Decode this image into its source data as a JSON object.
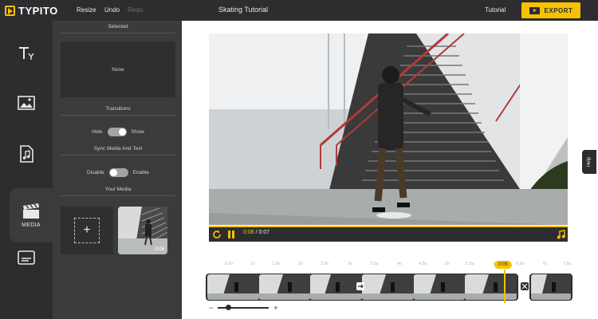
{
  "app": {
    "logo_text": "TYPITO",
    "title": "Skating Tutorial"
  },
  "topbar": {
    "resize_label": "Resize",
    "undo_label": "Undo",
    "redo_label": "Redo",
    "tutorial_label": "Tutorial",
    "export_label": "EXPORT"
  },
  "rail": {
    "items": [
      {
        "icon": "text-icon",
        "label": ""
      },
      {
        "icon": "image-icon",
        "label": ""
      },
      {
        "icon": "music-icon",
        "label": ""
      },
      {
        "icon": "clapperboard-icon",
        "label": "MEDIA",
        "active": true
      },
      {
        "icon": "subtitles-icon",
        "label": ""
      }
    ]
  },
  "panel": {
    "selected_title": "Selected",
    "selected_value": "None",
    "transitions_title": "Transitions",
    "transitions_off": "Hide",
    "transitions_on": "Show",
    "sync_title": "Sync Media And Text",
    "sync_off": "Disable",
    "sync_on": "Enable",
    "your_media_title": "Your Media",
    "media_duration": "0:08"
  },
  "player": {
    "current_time": "0:06",
    "separator": "/",
    "total_time": "0:07"
  },
  "help_label": "Help",
  "timeline": {
    "playhead_time": "0:06",
    "ticks": [
      "0.5s",
      "1s",
      "1.5s",
      "2s",
      "2.5s",
      "3s",
      "3.5s",
      "4s",
      "4.5s",
      "5s",
      "5.5s",
      "6s",
      "6.5s",
      "7s",
      "7.5s"
    ],
    "zoom_minus": "−",
    "zoom_plus": "+"
  },
  "colors": {
    "accent": "#f6c200",
    "dark": "#2d2d30",
    "panel": "#3b3b3d",
    "stage": "#ffffff"
  }
}
